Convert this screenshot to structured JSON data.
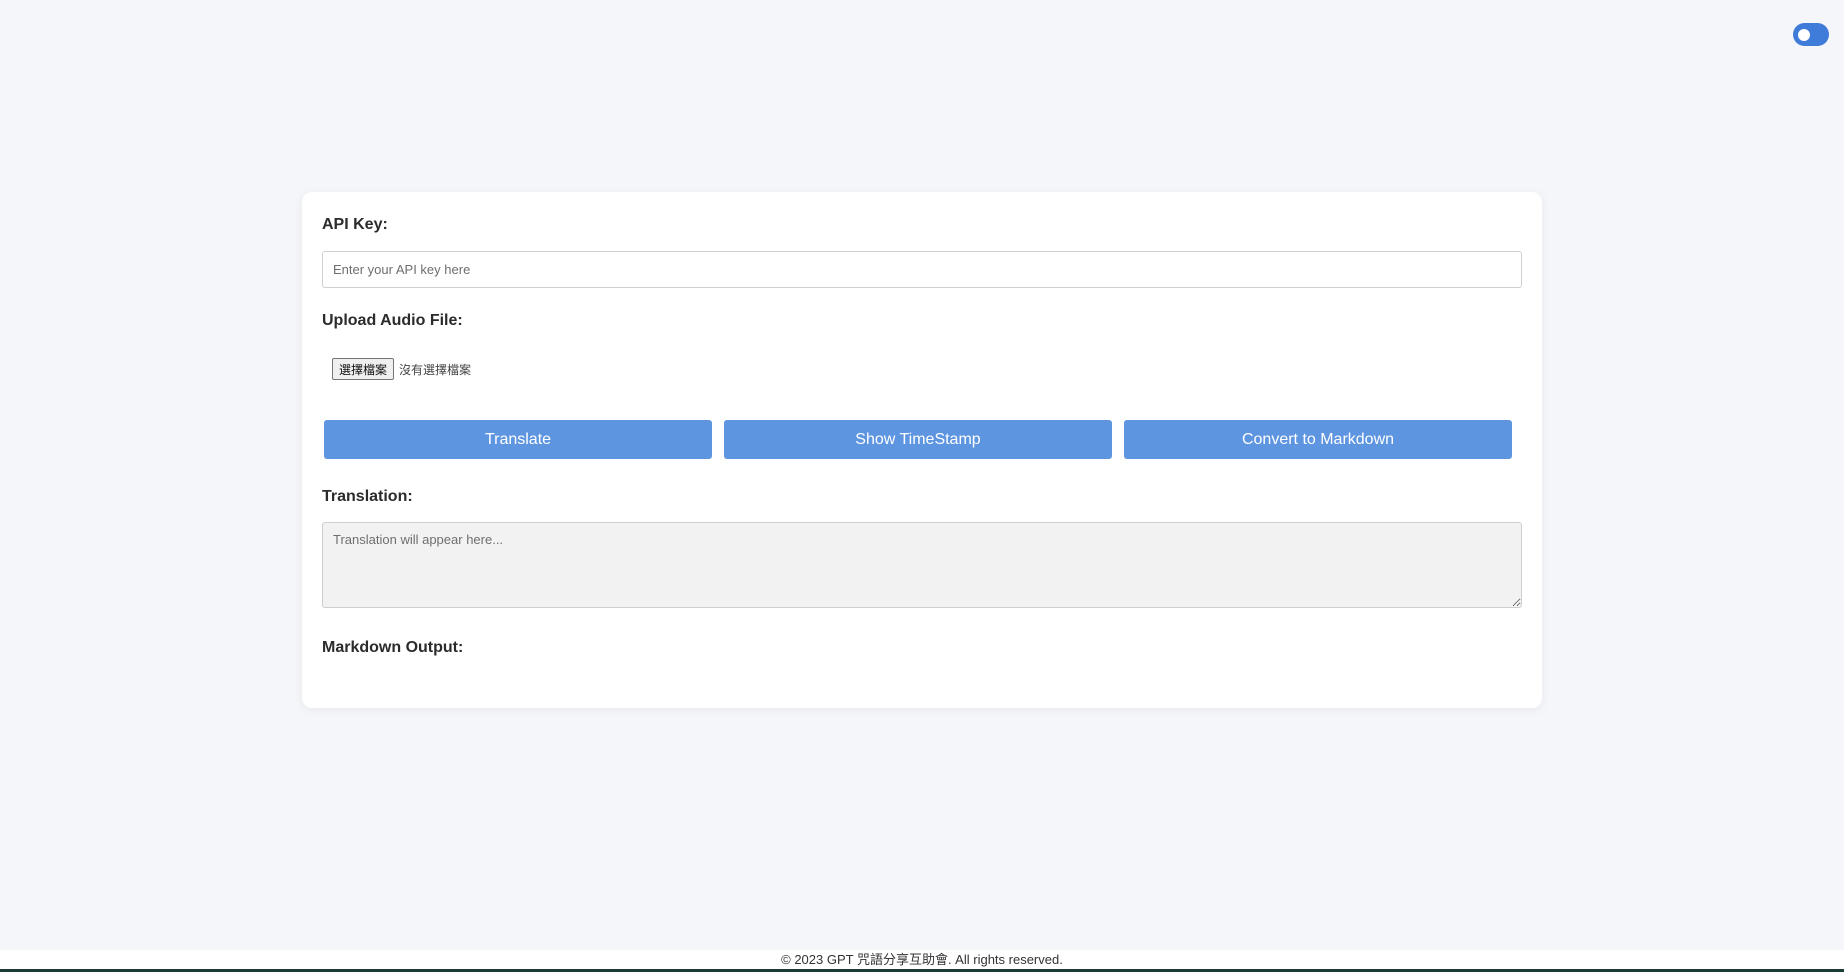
{
  "theme_toggle": {
    "state": "on",
    "color": "#3f7bd8"
  },
  "form": {
    "api_key_label": "API Key:",
    "api_key_placeholder": "Enter your API key here",
    "api_key_value": "",
    "upload_label": "Upload Audio File:",
    "file_button_label": "選擇檔案",
    "file_status": "沒有選擇檔案",
    "buttons": {
      "translate": "Translate",
      "timestamp": "Show TimeStamp",
      "markdown": "Convert to Markdown"
    },
    "translation_label": "Translation:",
    "translation_placeholder": "Translation will appear here...",
    "markdown_label": "Markdown Output:"
  },
  "footer": {
    "text": "© 2023 GPT 咒語分享互助會. All rights reserved."
  },
  "colors": {
    "accent": "#5e95e0",
    "page_background": "#f5f6fa",
    "card_background": "#ffffff"
  }
}
